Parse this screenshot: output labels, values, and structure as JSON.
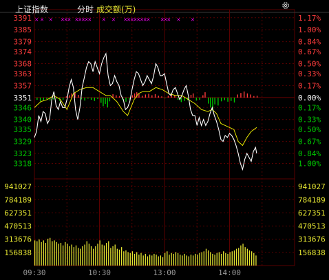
{
  "header": {
    "index_name": "上证指数",
    "mode": "分时",
    "volume_label": "成交额(万)"
  },
  "colors": {
    "background": "#000000",
    "up": "#ff3c3c",
    "down": "#00c800",
    "neutral": "#ffffff",
    "price_line": "#ffffff",
    "avg_line": "#e6e600",
    "volume": "#e6e632",
    "grid": "#5a0000",
    "marker": "#ff00ff"
  },
  "chart_data": {
    "type": "line",
    "price_axis": {
      "prev_close": 3351,
      "ticks": [
        3391,
        3385,
        3379,
        3374,
        3368,
        3363,
        3357,
        3351,
        3346,
        3340,
        3335,
        3329,
        3323,
        3318
      ],
      "pct_ticks": [
        "1.17%",
        "1.00%",
        "0.84%",
        "0.67%",
        "0.50%",
        "0.33%",
        "0.17%",
        "0.00%",
        "0.17%",
        "0.33%",
        "0.50%",
        "0.67%",
        "0.84%",
        "1.00%"
      ],
      "ylim": [
        3313,
        3393
      ]
    },
    "time_axis": {
      "labels": [
        "09:30",
        "10:30",
        "13:00",
        "14:00"
      ],
      "session_minutes": 240,
      "label_minutes": [
        0,
        60,
        120,
        180
      ],
      "data_minutes": 205
    },
    "price": [
      {
        "t": 0,
        "v": 3331
      },
      {
        "t": 2,
        "v": 3334
      },
      {
        "t": 4,
        "v": 3342
      },
      {
        "t": 6,
        "v": 3339
      },
      {
        "t": 8,
        "v": 3344
      },
      {
        "t": 10,
        "v": 3343
      },
      {
        "t": 12,
        "v": 3338
      },
      {
        "t": 14,
        "v": 3340
      },
      {
        "t": 16,
        "v": 3350
      },
      {
        "t": 18,
        "v": 3354
      },
      {
        "t": 20,
        "v": 3347
      },
      {
        "t": 22,
        "v": 3345
      },
      {
        "t": 24,
        "v": 3349
      },
      {
        "t": 26,
        "v": 3346
      },
      {
        "t": 28,
        "v": 3346
      },
      {
        "t": 30,
        "v": 3350
      },
      {
        "t": 32,
        "v": 3356
      },
      {
        "t": 34,
        "v": 3360
      },
      {
        "t": 36,
        "v": 3356
      },
      {
        "t": 38,
        "v": 3345
      },
      {
        "t": 40,
        "v": 3340
      },
      {
        "t": 42,
        "v": 3346
      },
      {
        "t": 44,
        "v": 3356
      },
      {
        "t": 46,
        "v": 3361
      },
      {
        "t": 48,
        "v": 3366
      },
      {
        "t": 50,
        "v": 3369
      },
      {
        "t": 52,
        "v": 3368
      },
      {
        "t": 54,
        "v": 3364
      },
      {
        "t": 56,
        "v": 3369
      },
      {
        "t": 58,
        "v": 3366
      },
      {
        "t": 60,
        "v": 3363
      },
      {
        "t": 62,
        "v": 3368
      },
      {
        "t": 64,
        "v": 3371
      },
      {
        "t": 66,
        "v": 3373
      },
      {
        "t": 68,
        "v": 3362
      },
      {
        "t": 70,
        "v": 3357
      },
      {
        "t": 72,
        "v": 3358
      },
      {
        "t": 74,
        "v": 3362
      },
      {
        "t": 76,
        "v": 3359
      },
      {
        "t": 78,
        "v": 3357
      },
      {
        "t": 80,
        "v": 3352
      },
      {
        "t": 82,
        "v": 3350
      },
      {
        "t": 84,
        "v": 3345
      },
      {
        "t": 86,
        "v": 3346
      },
      {
        "t": 88,
        "v": 3349
      },
      {
        "t": 90,
        "v": 3355
      },
      {
        "t": 92,
        "v": 3360
      },
      {
        "t": 94,
        "v": 3364
      },
      {
        "t": 96,
        "v": 3363
      },
      {
        "t": 98,
        "v": 3360
      },
      {
        "t": 100,
        "v": 3357
      },
      {
        "t": 102,
        "v": 3359
      },
      {
        "t": 104,
        "v": 3362
      },
      {
        "t": 106,
        "v": 3360
      },
      {
        "t": 108,
        "v": 3358
      },
      {
        "t": 110,
        "v": 3362
      },
      {
        "t": 112,
        "v": 3368
      },
      {
        "t": 114,
        "v": 3366
      },
      {
        "t": 116,
        "v": 3362
      },
      {
        "t": 118,
        "v": 3362
      },
      {
        "t": 120,
        "v": 3363
      },
      {
        "t": 122,
        "v": 3358
      },
      {
        "t": 124,
        "v": 3353
      },
      {
        "t": 126,
        "v": 3352
      },
      {
        "t": 128,
        "v": 3355
      },
      {
        "t": 130,
        "v": 3356
      },
      {
        "t": 132,
        "v": 3353
      },
      {
        "t": 134,
        "v": 3350
      },
      {
        "t": 136,
        "v": 3352
      },
      {
        "t": 138,
        "v": 3355
      },
      {
        "t": 140,
        "v": 3357
      },
      {
        "t": 142,
        "v": 3352
      },
      {
        "t": 144,
        "v": 3345
      },
      {
        "t": 146,
        "v": 3342
      },
      {
        "t": 148,
        "v": 3342
      },
      {
        "t": 150,
        "v": 3337
      },
      {
        "t": 152,
        "v": 3341
      },
      {
        "t": 154,
        "v": 3337
      },
      {
        "t": 156,
        "v": 3340
      },
      {
        "t": 158,
        "v": 3337
      },
      {
        "t": 160,
        "v": 3339
      },
      {
        "t": 162,
        "v": 3343
      },
      {
        "t": 164,
        "v": 3346
      },
      {
        "t": 166,
        "v": 3342
      },
      {
        "t": 168,
        "v": 3339
      },
      {
        "t": 170,
        "v": 3335
      },
      {
        "t": 172,
        "v": 3330
      },
      {
        "t": 174,
        "v": 3329
      },
      {
        "t": 176,
        "v": 3332
      },
      {
        "t": 178,
        "v": 3331
      },
      {
        "t": 180,
        "v": 3333
      },
      {
        "t": 182,
        "v": 3332
      },
      {
        "t": 184,
        "v": 3330
      },
      {
        "t": 186,
        "v": 3327
      },
      {
        "t": 188,
        "v": 3323
      },
      {
        "t": 190,
        "v": 3318
      },
      {
        "t": 192,
        "v": 3315
      },
      {
        "t": 194,
        "v": 3320
      },
      {
        "t": 196,
        "v": 3323
      },
      {
        "t": 198,
        "v": 3321
      },
      {
        "t": 200,
        "v": 3319
      },
      {
        "t": 202,
        "v": 3324
      },
      {
        "t": 204,
        "v": 3326
      },
      {
        "t": 205,
        "v": 3323
      }
    ],
    "avg_price": [
      {
        "t": 0,
        "v": 3346
      },
      {
        "t": 6,
        "v": 3349
      },
      {
        "t": 12,
        "v": 3350
      },
      {
        "t": 18,
        "v": 3352
      },
      {
        "t": 24,
        "v": 3350
      },
      {
        "t": 30,
        "v": 3345
      },
      {
        "t": 36,
        "v": 3353
      },
      {
        "t": 42,
        "v": 3355
      },
      {
        "t": 48,
        "v": 3356
      },
      {
        "t": 54,
        "v": 3356
      },
      {
        "t": 60,
        "v": 3354
      },
      {
        "t": 66,
        "v": 3352
      },
      {
        "t": 70,
        "v": 3352
      },
      {
        "t": 76,
        "v": 3349
      },
      {
        "t": 82,
        "v": 3344
      },
      {
        "t": 86,
        "v": 3342
      },
      {
        "t": 92,
        "v": 3350
      },
      {
        "t": 96,
        "v": 3353
      },
      {
        "t": 100,
        "v": 3354
      },
      {
        "t": 106,
        "v": 3354
      },
      {
        "t": 112,
        "v": 3356
      },
      {
        "t": 118,
        "v": 3355
      },
      {
        "t": 124,
        "v": 3353
      },
      {
        "t": 130,
        "v": 3352
      },
      {
        "t": 136,
        "v": 3352
      },
      {
        "t": 142,
        "v": 3350
      },
      {
        "t": 148,
        "v": 3348
      },
      {
        "t": 154,
        "v": 3345
      },
      {
        "t": 160,
        "v": 3344
      },
      {
        "t": 164,
        "v": 3345
      },
      {
        "t": 168,
        "v": 3343
      },
      {
        "t": 172,
        "v": 3338
      },
      {
        "t": 176,
        "v": 3337
      },
      {
        "t": 180,
        "v": 3336
      },
      {
        "t": 184,
        "v": 3335
      },
      {
        "t": 188,
        "v": 3329
      },
      {
        "t": 192,
        "v": 3327
      },
      {
        "t": 196,
        "v": 3331
      },
      {
        "t": 200,
        "v": 3334
      },
      {
        "t": 205,
        "v": 3336
      }
    ],
    "indicator_bars": [
      {
        "t": 2,
        "v": -0.6
      },
      {
        "t": 5,
        "v": -1.0
      },
      {
        "t": 8,
        "v": -0.7
      },
      {
        "t": 11,
        "v": -0.4
      },
      {
        "t": 14,
        "v": -0.8
      },
      {
        "t": 17,
        "v": -0.5
      },
      {
        "t": 20,
        "v": -0.3
      },
      {
        "t": 23,
        "v": -0.9
      },
      {
        "t": 26,
        "v": -0.6
      },
      {
        "t": 29,
        "v": 0.3
      },
      {
        "t": 32,
        "v": 0.6
      },
      {
        "t": 34,
        "v": 1.1
      },
      {
        "t": 37,
        "v": 1.3
      },
      {
        "t": 40,
        "v": 0.7
      },
      {
        "t": 43,
        "v": -0.5
      },
      {
        "t": 46,
        "v": -0.8
      },
      {
        "t": 49,
        "v": -0.3
      },
      {
        "t": 52,
        "v": -0.6
      },
      {
        "t": 55,
        "v": -0.9
      },
      {
        "t": 58,
        "v": -0.4
      },
      {
        "t": 61,
        "v": -1.4
      },
      {
        "t": 63,
        "v": -2.3
      },
      {
        "t": 65,
        "v": -1.7
      },
      {
        "t": 67,
        "v": -2.6
      },
      {
        "t": 69,
        "v": -1.0
      },
      {
        "t": 72,
        "v": 0.9
      },
      {
        "t": 75,
        "v": 0.6
      },
      {
        "t": 78,
        "v": 0.4
      },
      {
        "t": 81,
        "v": -0.7
      },
      {
        "t": 84,
        "v": -1.1
      },
      {
        "t": 87,
        "v": -0.5
      },
      {
        "t": 90,
        "v": 0.6
      },
      {
        "t": 92,
        "v": 1.1
      },
      {
        "t": 94,
        "v": 1.4
      },
      {
        "t": 96,
        "v": 0.9
      },
      {
        "t": 99,
        "v": 0.5
      },
      {
        "t": 102,
        "v": 0.8
      },
      {
        "t": 105,
        "v": 1.0
      },
      {
        "t": 108,
        "v": 0.6
      },
      {
        "t": 111,
        "v": 0.9
      },
      {
        "t": 114,
        "v": 0.5
      },
      {
        "t": 117,
        "v": 0.3
      },
      {
        "t": 120,
        "v": -0.2
      },
      {
        "t": 123,
        "v": 0.5
      },
      {
        "t": 126,
        "v": 0.9
      },
      {
        "t": 129,
        "v": 0.5
      },
      {
        "t": 132,
        "v": -0.6
      },
      {
        "t": 135,
        "v": -1.2
      },
      {
        "t": 138,
        "v": -0.9
      },
      {
        "t": 141,
        "v": -0.7
      },
      {
        "t": 144,
        "v": 0.7
      },
      {
        "t": 146,
        "v": 1.1
      },
      {
        "t": 149,
        "v": -0.8
      },
      {
        "t": 152,
        "v": -0.6
      },
      {
        "t": 155,
        "v": 0.6
      },
      {
        "t": 157,
        "v": 1.4
      },
      {
        "t": 160,
        "v": -1.6
      },
      {
        "t": 162,
        "v": -2.6
      },
      {
        "t": 164,
        "v": -3.5
      },
      {
        "t": 166,
        "v": -1.8
      },
      {
        "t": 169,
        "v": -2.1
      },
      {
        "t": 172,
        "v": -1.0
      },
      {
        "t": 175,
        "v": -0.7
      },
      {
        "t": 178,
        "v": -1.1
      },
      {
        "t": 181,
        "v": -0.9
      },
      {
        "t": 184,
        "v": -1.3
      },
      {
        "t": 187,
        "v": 0.8
      },
      {
        "t": 190,
        "v": 1.2
      },
      {
        "t": 193,
        "v": 1.6
      },
      {
        "t": 196,
        "v": 1.1
      },
      {
        "t": 199,
        "v": 0.8
      },
      {
        "t": 202,
        "v": 0.4
      },
      {
        "t": 205,
        "v": 0.5
      }
    ],
    "markers": [
      {
        "t": 2,
        "glyph": "✕"
      },
      {
        "t": 7,
        "glyph": "✕"
      },
      {
        "t": 15,
        "glyph": "✕"
      },
      {
        "t": 26,
        "glyph": "✕"
      },
      {
        "t": 29,
        "glyph": "✕"
      },
      {
        "t": 32,
        "glyph": "✕"
      },
      {
        "t": 39,
        "glyph": "✕"
      },
      {
        "t": 42,
        "glyph": "✕"
      },
      {
        "t": 45,
        "glyph": "✕"
      },
      {
        "t": 48,
        "glyph": "✕"
      },
      {
        "t": 51,
        "glyph": "✕"
      },
      {
        "t": 64,
        "glyph": "✕"
      },
      {
        "t": 73,
        "glyph": "✕"
      },
      {
        "t": 84,
        "glyph": "✕"
      },
      {
        "t": 87,
        "glyph": "✕"
      },
      {
        "t": 90,
        "glyph": "✕"
      },
      {
        "t": 93,
        "glyph": "✕"
      },
      {
        "t": 96,
        "glyph": "✕"
      },
      {
        "t": 99,
        "glyph": "✕"
      },
      {
        "t": 102,
        "glyph": "✕"
      },
      {
        "t": 105,
        "glyph": "✕"
      },
      {
        "t": 118,
        "glyph": "✕"
      },
      {
        "t": 121,
        "glyph": "✕"
      },
      {
        "t": 124,
        "glyph": "✕"
      },
      {
        "t": 133,
        "glyph": "✕"
      },
      {
        "t": 146,
        "glyph": "✕"
      }
    ],
    "volume_axis": {
      "ticks": [
        941027,
        784189,
        627351,
        470513,
        313676,
        156838
      ],
      "ylim": [
        0,
        1000000
      ]
    },
    "volume": [
      {
        "t": 0,
        "v": 300000
      },
      {
        "t": 2,
        "v": 290000
      },
      {
        "t": 4,
        "v": 310000
      },
      {
        "t": 6,
        "v": 280000
      },
      {
        "t": 8,
        "v": 300000
      },
      {
        "t": 10,
        "v": 270000
      },
      {
        "t": 12,
        "v": 320000
      },
      {
        "t": 14,
        "v": 330000
      },
      {
        "t": 16,
        "v": 290000
      },
      {
        "t": 18,
        "v": 300000
      },
      {
        "t": 20,
        "v": 280000
      },
      {
        "t": 22,
        "v": 260000
      },
      {
        "t": 24,
        "v": 270000
      },
      {
        "t": 26,
        "v": 240000
      },
      {
        "t": 28,
        "v": 280000
      },
      {
        "t": 30,
        "v": 260000
      },
      {
        "t": 32,
        "v": 230000
      },
      {
        "t": 34,
        "v": 250000
      },
      {
        "t": 36,
        "v": 220000
      },
      {
        "t": 38,
        "v": 240000
      },
      {
        "t": 40,
        "v": 210000
      },
      {
        "t": 42,
        "v": 200000
      },
      {
        "t": 44,
        "v": 230000
      },
      {
        "t": 46,
        "v": 250000
      },
      {
        "t": 48,
        "v": 290000
      },
      {
        "t": 50,
        "v": 260000
      },
      {
        "t": 52,
        "v": 230000
      },
      {
        "t": 54,
        "v": 200000
      },
      {
        "t": 56,
        "v": 230000
      },
      {
        "t": 58,
        "v": 260000
      },
      {
        "t": 60,
        "v": 300000
      },
      {
        "t": 62,
        "v": 250000
      },
      {
        "t": 64,
        "v": 240000
      },
      {
        "t": 66,
        "v": 270000
      },
      {
        "t": 68,
        "v": 290000
      },
      {
        "t": 70,
        "v": 210000
      },
      {
        "t": 72,
        "v": 230000
      },
      {
        "t": 74,
        "v": 250000
      },
      {
        "t": 76,
        "v": 200000
      },
      {
        "t": 78,
        "v": 190000
      },
      {
        "t": 80,
        "v": 220000
      },
      {
        "t": 82,
        "v": 170000
      },
      {
        "t": 84,
        "v": 180000
      },
      {
        "t": 86,
        "v": 160000
      },
      {
        "t": 88,
        "v": 150000
      },
      {
        "t": 90,
        "v": 170000
      },
      {
        "t": 92,
        "v": 140000
      },
      {
        "t": 94,
        "v": 160000
      },
      {
        "t": 96,
        "v": 130000
      },
      {
        "t": 98,
        "v": 150000
      },
      {
        "t": 100,
        "v": 120000
      },
      {
        "t": 102,
        "v": 140000
      },
      {
        "t": 104,
        "v": 110000
      },
      {
        "t": 106,
        "v": 130000
      },
      {
        "t": 108,
        "v": 120000
      },
      {
        "t": 110,
        "v": 140000
      },
      {
        "t": 112,
        "v": 130000
      },
      {
        "t": 114,
        "v": 110000
      },
      {
        "t": 116,
        "v": 120000
      },
      {
        "t": 118,
        "v": 100000
      },
      {
        "t": 120,
        "v": 150000
      },
      {
        "t": 122,
        "v": 170000
      },
      {
        "t": 124,
        "v": 130000
      },
      {
        "t": 126,
        "v": 150000
      },
      {
        "t": 128,
        "v": 140000
      },
      {
        "t": 130,
        "v": 160000
      },
      {
        "t": 132,
        "v": 150000
      },
      {
        "t": 134,
        "v": 130000
      },
      {
        "t": 136,
        "v": 120000
      },
      {
        "t": 138,
        "v": 140000
      },
      {
        "t": 140,
        "v": 120000
      },
      {
        "t": 142,
        "v": 110000
      },
      {
        "t": 144,
        "v": 130000
      },
      {
        "t": 146,
        "v": 120000
      },
      {
        "t": 148,
        "v": 140000
      },
      {
        "t": 150,
        "v": 130000
      },
      {
        "t": 152,
        "v": 150000
      },
      {
        "t": 154,
        "v": 160000
      },
      {
        "t": 156,
        "v": 170000
      },
      {
        "t": 158,
        "v": 200000
      },
      {
        "t": 160,
        "v": 180000
      },
      {
        "t": 162,
        "v": 160000
      },
      {
        "t": 164,
        "v": 140000
      },
      {
        "t": 166,
        "v": 130000
      },
      {
        "t": 168,
        "v": 150000
      },
      {
        "t": 170,
        "v": 160000
      },
      {
        "t": 172,
        "v": 140000
      },
      {
        "t": 174,
        "v": 170000
      },
      {
        "t": 176,
        "v": 150000
      },
      {
        "t": 178,
        "v": 140000
      },
      {
        "t": 180,
        "v": 160000
      },
      {
        "t": 182,
        "v": 170000
      },
      {
        "t": 184,
        "v": 180000
      },
      {
        "t": 186,
        "v": 200000
      },
      {
        "t": 188,
        "v": 210000
      },
      {
        "t": 190,
        "v": 240000
      },
      {
        "t": 192,
        "v": 260000
      },
      {
        "t": 194,
        "v": 220000
      },
      {
        "t": 196,
        "v": 200000
      },
      {
        "t": 198,
        "v": 180000
      },
      {
        "t": 200,
        "v": 170000
      },
      {
        "t": 202,
        "v": 150000
      },
      {
        "t": 204,
        "v": 120000
      }
    ]
  }
}
